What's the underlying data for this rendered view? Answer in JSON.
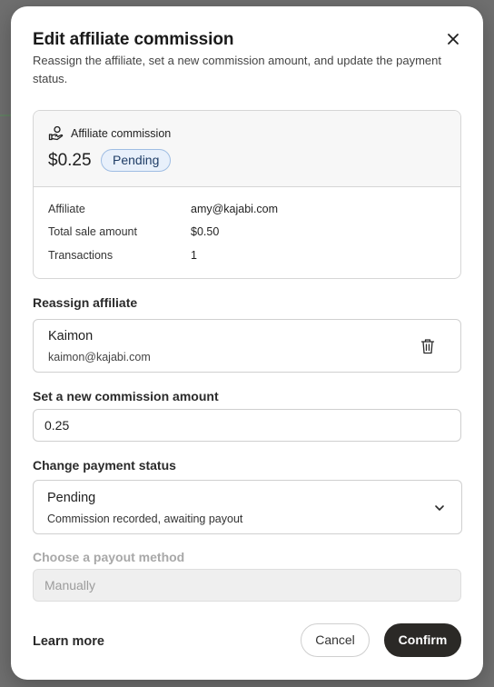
{
  "modal": {
    "title": "Edit affiliate commission",
    "subtitle": "Reassign the affiliate, set a new commission amount, and update the payment status."
  },
  "summary": {
    "label": "Affiliate commission",
    "amount": "$0.25",
    "status_badge": "Pending",
    "rows": [
      {
        "label": "Affiliate",
        "value": "amy@kajabi.com"
      },
      {
        "label": "Total sale amount",
        "value": "$0.50"
      },
      {
        "label": "Transactions",
        "value": "1"
      }
    ]
  },
  "reassign": {
    "label": "Reassign affiliate",
    "name": "Kaimon",
    "email": "kaimon@kajabi.com"
  },
  "commission": {
    "label": "Set a new commission amount",
    "value": "0.25"
  },
  "payment_status": {
    "label": "Change payment status",
    "selected": "Pending",
    "description": "Commission recorded, awaiting payout"
  },
  "payout": {
    "label": "Choose a payout method",
    "value": "Manually"
  },
  "footer": {
    "learn_more": "Learn more",
    "cancel": "Cancel",
    "confirm": "Confirm"
  },
  "colors": {
    "badge_bg": "#e8f0fb",
    "badge_border": "#9fbde3",
    "confirm_bg": "#2b2926"
  },
  "icons": {
    "close": "close-icon",
    "hand": "hand-coin-icon",
    "trash": "trash-icon",
    "chevron": "chevron-down-icon"
  }
}
